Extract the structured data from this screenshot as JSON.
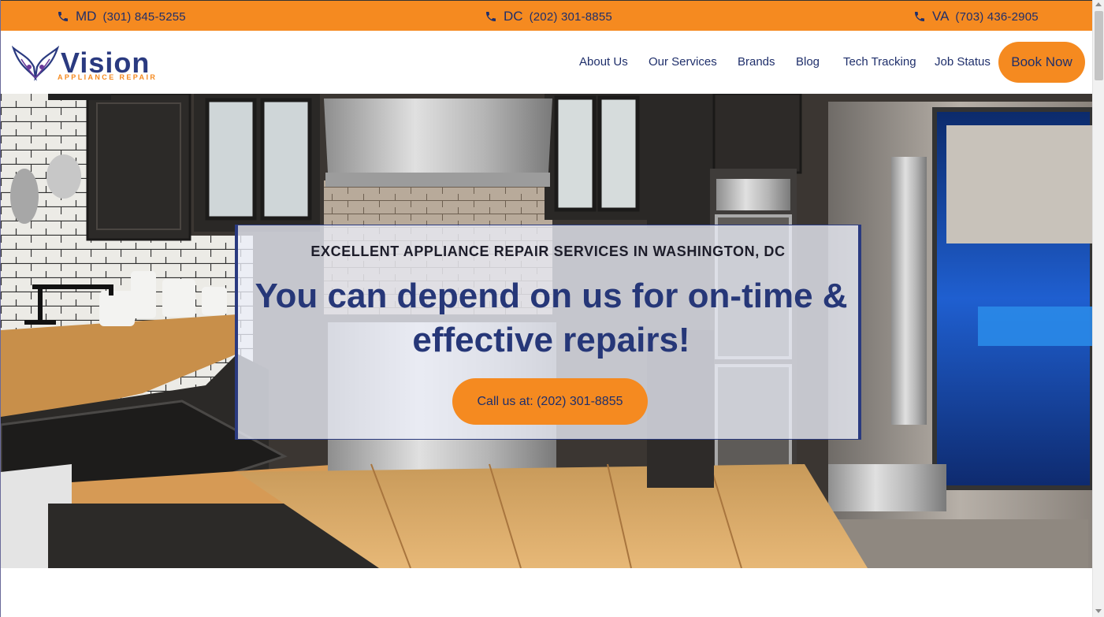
{
  "topbar": {
    "phones": [
      {
        "state": "MD",
        "number": "(301) 845-5255"
      },
      {
        "state": "DC",
        "number": "(202) 301-8855"
      },
      {
        "state": "VA",
        "number": "(703) 436-2905"
      }
    ],
    "icon": "phone-icon"
  },
  "brand": {
    "name": "Vision",
    "tagline": "APPLIANCE REPAIR"
  },
  "nav": {
    "items": [
      "About Us",
      "Our Services",
      "Brands",
      "Blog",
      "Tech Tracking",
      "Job Status"
    ],
    "book_label": "Book Now"
  },
  "hero": {
    "kicker": "EXCELLENT APPLIANCE REPAIR SERVICES IN WASHINGTON, DC",
    "title": "You can depend on us for on-time & effective repairs!",
    "cta_label": "Call us at: (202) 301-8855"
  },
  "colors": {
    "accent": "#f58a20",
    "brand_navy": "#263778"
  }
}
